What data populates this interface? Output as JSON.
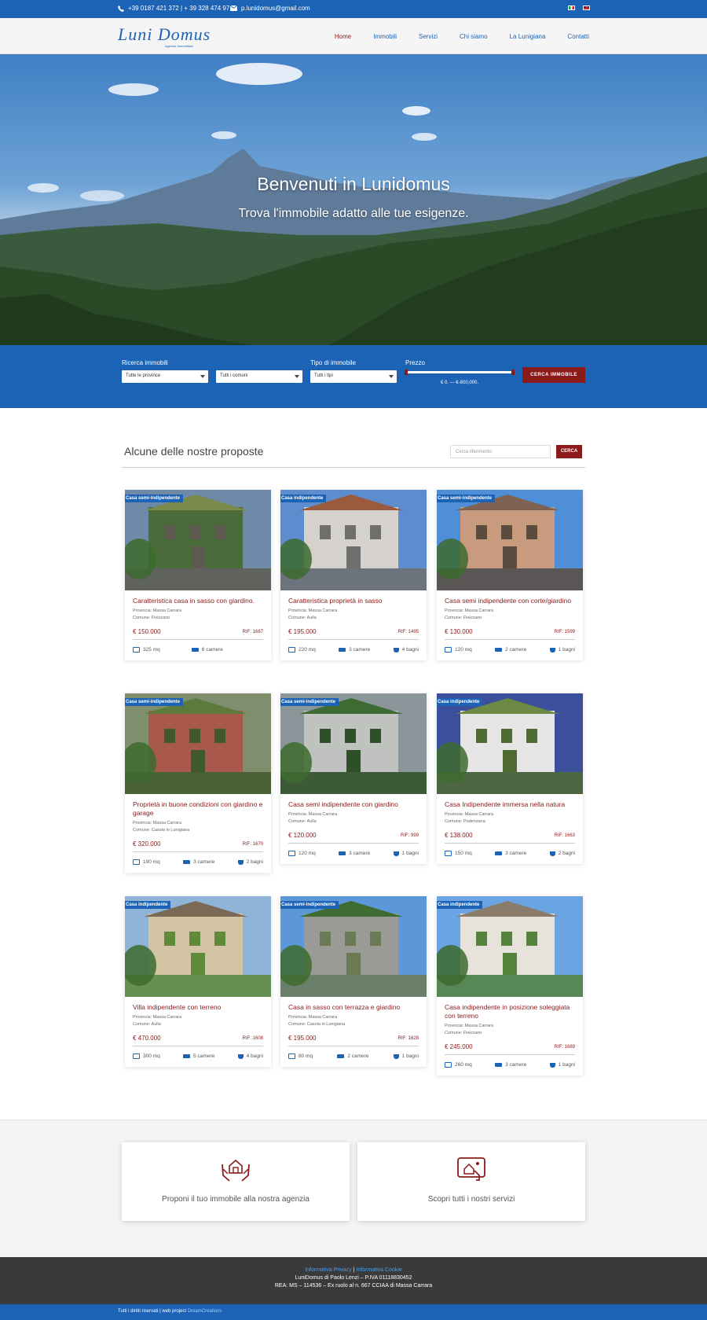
{
  "topbar": {
    "phones": "+39 0187 421 372 | + 39 328 474 9710",
    "email": "p.lunidomus@gmail.com"
  },
  "brand": {
    "name": "Luni Domus",
    "tagline": "Agenzia Immobiliare"
  },
  "nav": [
    "Home",
    "Immobili",
    "Servizi",
    "Chi siamo",
    "La Lunigiana",
    "Contatti"
  ],
  "hero": {
    "title": "Benvenuti in Lunidomus",
    "subtitle": "Trova l'immobile adatto alle tue esigenze."
  },
  "search": {
    "label_ricerca": "Ricerca immobili",
    "province_value": "Tutte le province",
    "comuni_value": "Tutti i comuni",
    "label_tipo": "Tipo di immobile",
    "tipo_value": "Tutti i tipi",
    "label_prezzo": "Prezzo",
    "price_range": "€ 0. — €-800,000.",
    "price_min": 0,
    "price_max": 800000,
    "button": "CERCA IMMOBILE"
  },
  "proposals": {
    "title": "Alcune delle nostre proposte",
    "ref_placeholder": "Cerca riferimento",
    "ref_button": "CERCA"
  },
  "listings": [
    {
      "badge": "Casa semi-indipendente",
      "title": "Caratteristica casa in sasso con giardino.",
      "provincia": "Provincia: Massa Carrara",
      "comune": "Comune: Fivizzano",
      "price": "€ 150.000",
      "rif": "RIF: 1687",
      "area": "325 mq",
      "rooms": "6 camere",
      "baths": ""
    },
    {
      "badge": "Casa indipendente",
      "title": "Caratteristica proprietà in sasso",
      "provincia": "Provincia: Massa Carrara",
      "comune": "Comune: Aulla",
      "price": "€ 195.000",
      "rif": "RIF: 1495",
      "area": "220 mq",
      "rooms": "3 camere",
      "baths": "4 bagni"
    },
    {
      "badge": "Casa semi-indipendente",
      "title": "Casa semi indipendente con corte/giardino",
      "provincia": "Provincia: Massa Carrara",
      "comune": "Comune: Fivizzano",
      "price": "€ 130.000",
      "rif": "RIF: 1599",
      "area": "120 mq",
      "rooms": "2 camere",
      "baths": "1 bagni"
    },
    {
      "badge": "Casa semi-indipendente",
      "title": "Proprietà in buone condizioni con giardino e garage",
      "provincia": "Provincia: Massa Carrara",
      "comune": "Comune: Casola in Lunigiana",
      "price": "€ 320.000",
      "rif": "RIF: 1670",
      "area": "190 mq",
      "rooms": "3 camere",
      "baths": "2 bagni"
    },
    {
      "badge": "Casa semi-indipendente",
      "title": "Casa semi indipendente con giardino",
      "provincia": "Provincia: Massa Carrara",
      "comune": "Comune: Aulla",
      "price": "€ 120.000",
      "rif": "RIF: 999",
      "area": "120 mq",
      "rooms": "3 camere",
      "baths": "1 bagni"
    },
    {
      "badge": "Casa indipendente",
      "title": "Casa Indipendente immersa nella natura",
      "provincia": "Provincia: Massa Carrara",
      "comune": "Comune: Podenzana",
      "price": "€ 138.000",
      "rif": "RIF: 1663",
      "area": "150 mq",
      "rooms": "3 camere",
      "baths": "2 bagni"
    },
    {
      "badge": "Casa indipendente",
      "title": "Villa indipendente con terreno",
      "provincia": "Provincia: Massa Carrara",
      "comune": "Comune: Aulla",
      "price": "€ 470.000",
      "rif": "RIF: 1608",
      "area": "300 mq",
      "rooms": "5 camere",
      "baths": "4 bagni"
    },
    {
      "badge": "Casa semi-indipendente",
      "title": "Casa in sasso con terrazza e giardino",
      "provincia": "Provincia: Massa Carrara",
      "comune": "Comune: Casola in Lunigiana",
      "price": "€ 195.000",
      "rif": "RIF: 1628",
      "area": "80 mq",
      "rooms": "2 camere",
      "baths": "1 bagni"
    },
    {
      "badge": "Casa indipendente",
      "title": "Casa indipendente in posizione soleggiata con terreno",
      "provincia": "Provincia: Massa Carrara",
      "comune": "Comune: Fivizzano",
      "price": "€ 245.000",
      "rif": "RIF: 1689",
      "area": "260 mq",
      "rooms": "3 camere",
      "baths": "1 bagni"
    }
  ],
  "cta": {
    "propose": "Proponi il tuo immobile alla nostra agenzia",
    "services": "Scopri tutti i nostri servizi"
  },
  "footer": {
    "privacy": "Informativa Privacy",
    "cookie": "Informativa Cookie",
    "company": "LuniDomus di Paolo Lenzi – P.IVA 01118830452",
    "rea": "REA: MS – 114536 – Ex ruolo al n. 667 CCIAA di Massa Carrara",
    "rights": "Tutti i diritti riservati | web project ",
    "credit": "DreamCreations"
  },
  "colors": {
    "primary": "#1c63b5",
    "accent": "#8b1a1a"
  }
}
